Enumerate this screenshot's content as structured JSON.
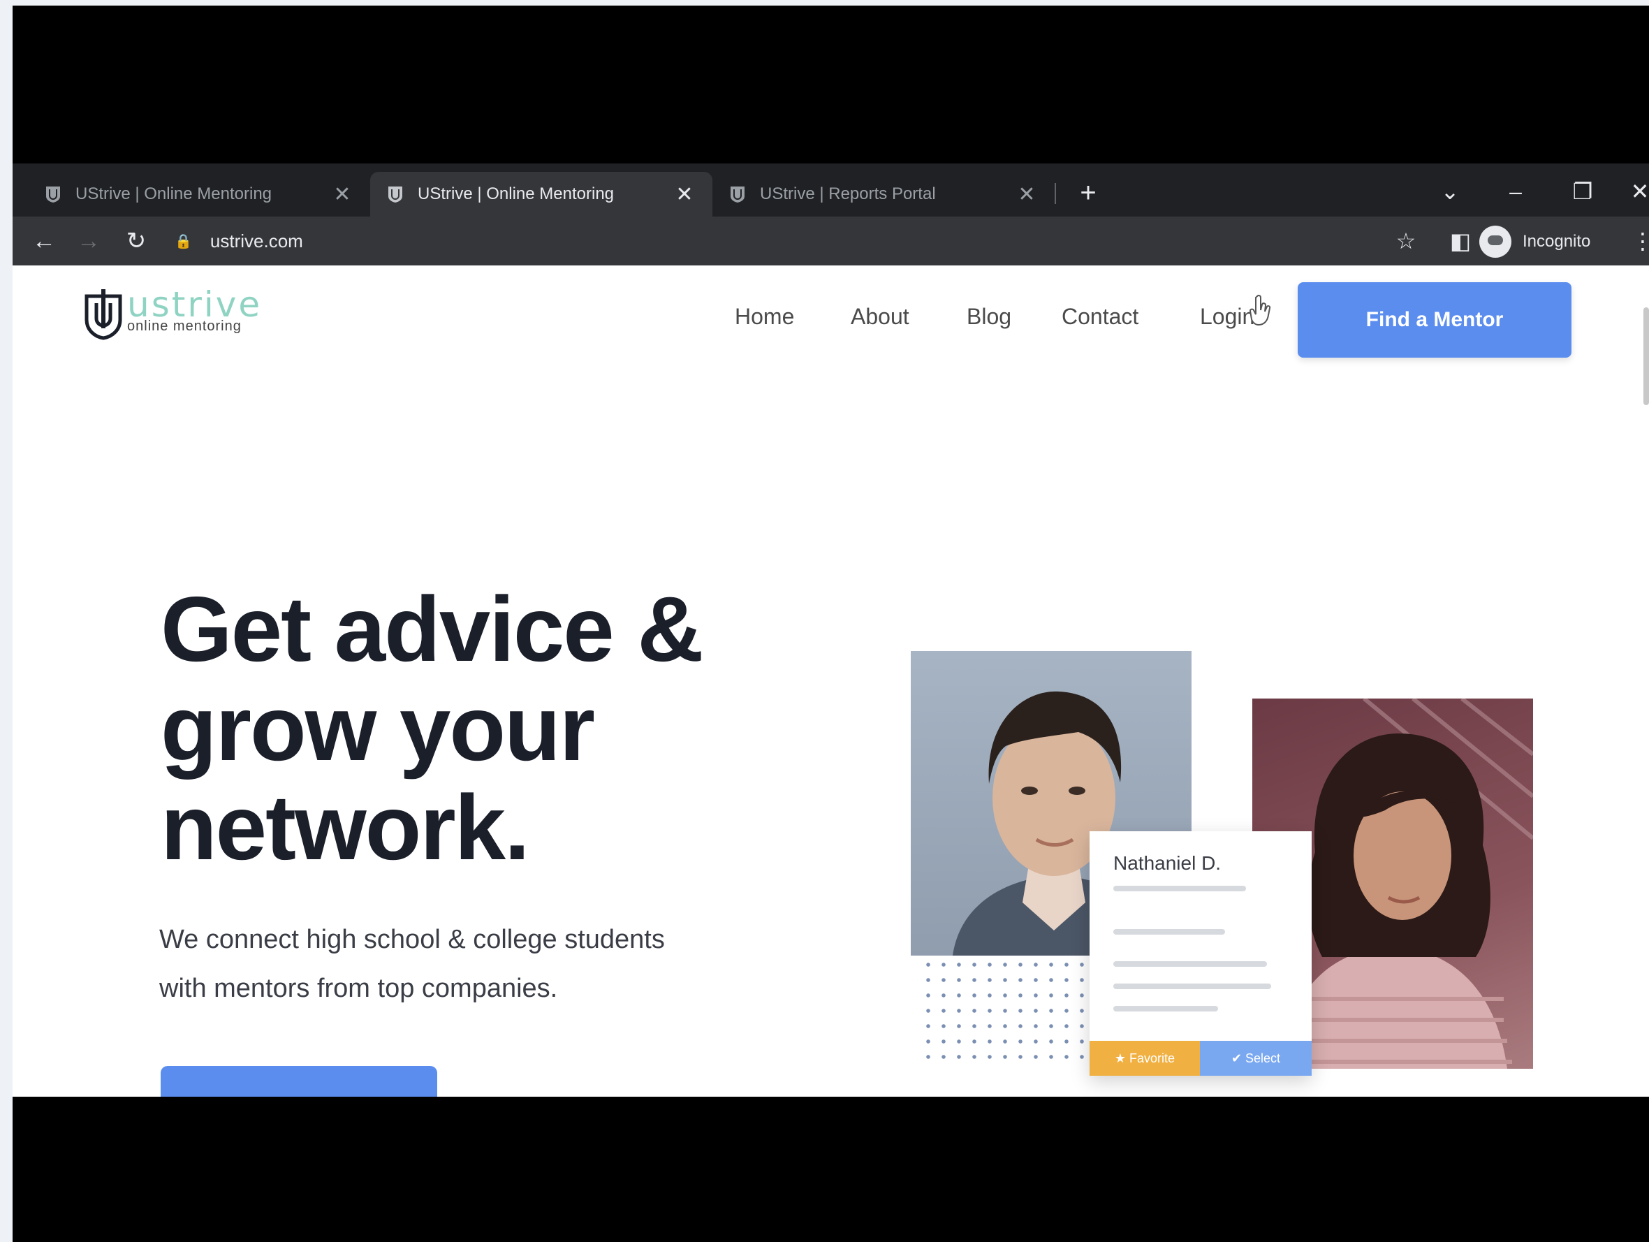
{
  "browser": {
    "tabs": [
      {
        "label": "UStrive | Online Mentoring",
        "active": false
      },
      {
        "label": "UStrive | Online Mentoring",
        "active": true
      },
      {
        "label": "UStrive | Reports Portal",
        "active": false
      }
    ],
    "new_tab_glyph": "+",
    "address": "ustrive.com",
    "profile_label": "Incognito"
  },
  "site": {
    "logo": {
      "word": "ustrive",
      "tagline": "online mentoring"
    },
    "nav": [
      {
        "label": "Home"
      },
      {
        "label": "About"
      },
      {
        "label": "Blog"
      },
      {
        "label": "Contact"
      },
      {
        "label": "Login"
      }
    ],
    "cta_label": "Find a Mentor"
  },
  "hero": {
    "title_lines": [
      "Get advice &",
      "grow your",
      "network."
    ],
    "subtitle_lines": [
      "We connect high school & college students",
      "with mentors from top companies."
    ]
  },
  "mentor_card": {
    "name": "Nathaniel D.",
    "favorite_label": "★ Favorite",
    "select_label": "✔ Select"
  },
  "icons": {
    "tab_favicon": "ustrive-shield-icon",
    "back": "arrow-left-icon",
    "forward": "arrow-right-icon",
    "reload": "reload-icon",
    "lock": "lock-icon",
    "bookmark": "star-icon",
    "extensions": "panel-icon"
  },
  "colors": {
    "brand_blue": "#5b8def",
    "logo_teal": "#8fd3c2",
    "favorite_orange": "#f0b042",
    "select_blue": "#7aa8f0",
    "chrome_dark": "#202124",
    "chrome_toolbar": "#35363a"
  }
}
